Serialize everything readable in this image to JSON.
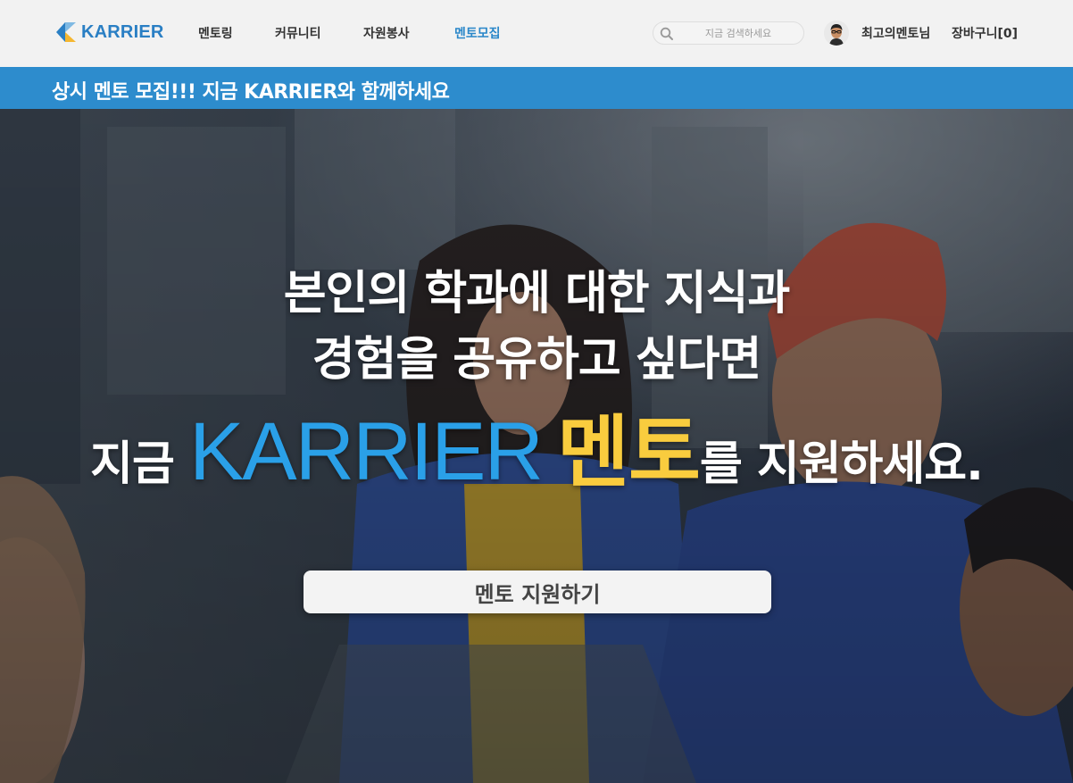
{
  "header": {
    "logo_text": "KARRIER",
    "nav": [
      {
        "label": "멘토링"
      },
      {
        "label": "커뮤니티"
      },
      {
        "label": "자원봉사"
      },
      {
        "label": "멘토모집",
        "active": true
      }
    ],
    "search": {
      "placeholder": "지금 검색하세요",
      "value": ""
    },
    "user_name": "최고의멘토님",
    "cart_label": "장바구니[0]"
  },
  "banner": {
    "text": "상시 멘토 모집!!! 지금 KARRIER와 함께하세요"
  },
  "hero": {
    "line1": "본인의 학과에 대한 지식과",
    "line2": "경험을 공유하고 싶다면",
    "line3_prefix": "지금 ",
    "line3_brand": "KARRIER",
    "line3_mentor": "멘토",
    "line3_suffix": "를 지원하세요.",
    "cta_label": "멘토 지원하기"
  },
  "colors": {
    "brand_blue": "#2a7fc4",
    "banner_blue": "#2d8ccd",
    "active_nav": "#2a87c9",
    "hero_brand": "#2aa0e8",
    "hero_mentor": "#f9cc3e"
  },
  "icons": {
    "logo": "karrier-logo-icon",
    "search": "search-icon",
    "avatar": "avatar-icon"
  }
}
